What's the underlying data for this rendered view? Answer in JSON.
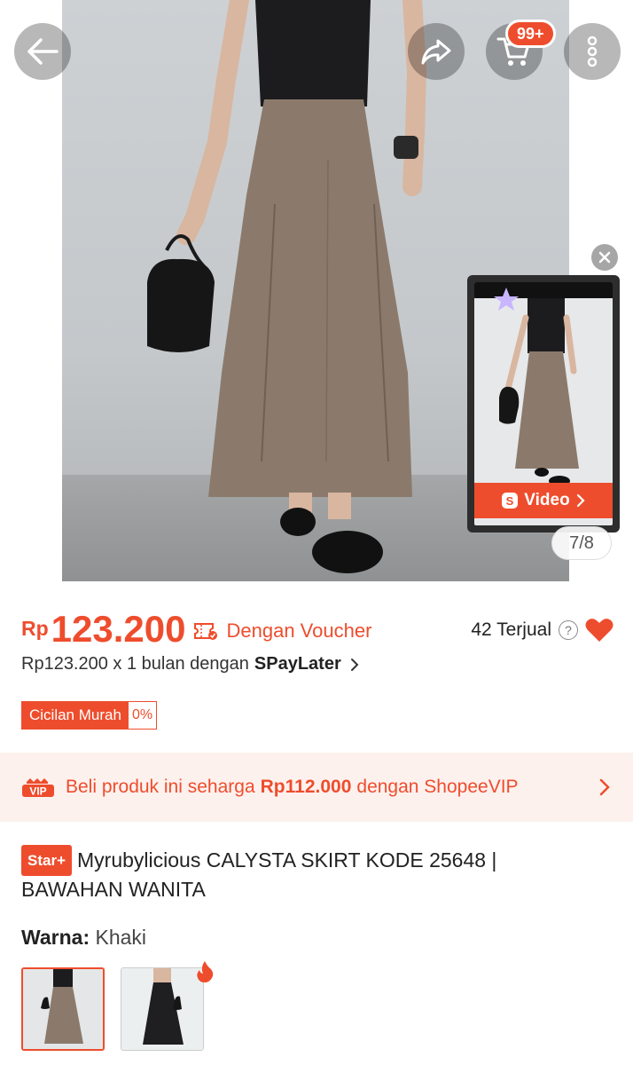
{
  "header": {
    "cart_badge": "99+"
  },
  "gallery": {
    "video_label": "Video",
    "counter": "7/8"
  },
  "price": {
    "currency": "Rp",
    "amount": "123.200",
    "voucher_label": "Dengan Voucher",
    "sold": "42 Terjual",
    "paylater_prefix": "Rp123.200 x 1 bulan dengan",
    "paylater_brand": "SPayLater",
    "installment_label": "Cicilan Murah",
    "installment_rate": "0%"
  },
  "vip": {
    "badge": "VIP",
    "text_before": "Beli produk ini seharga",
    "price": "Rp112.000",
    "text_after": "dengan ShopeeVIP"
  },
  "product": {
    "badge": "Star+",
    "title": "Myrubylicious CALYSTA SKIRT KODE 25648 | BAWAHAN WANITA"
  },
  "variant": {
    "label": "Warna:",
    "value": "Khaki"
  },
  "colors": {
    "accent": "#ee4d2d",
    "skirt_khaki": "#8b7a6c",
    "skirt_black": "#1f1f22"
  }
}
